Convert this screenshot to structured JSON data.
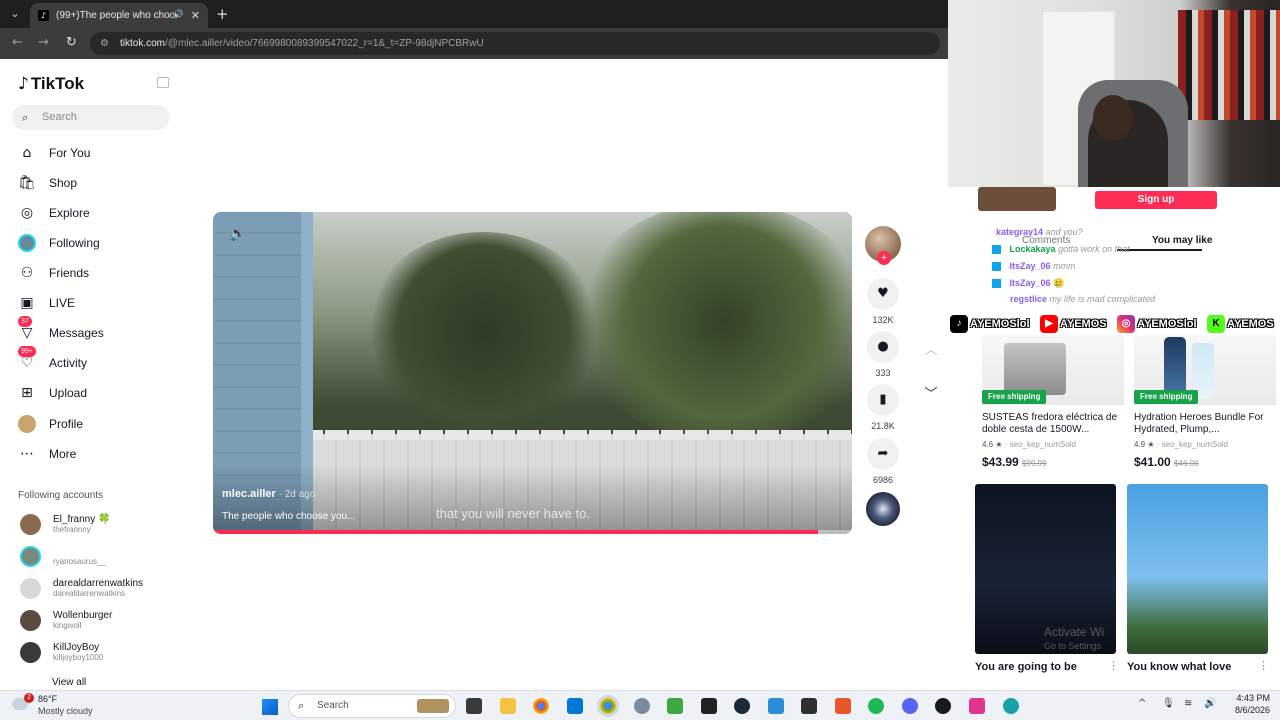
{
  "browser": {
    "tab_title": "(99+)The people who choo",
    "url_domain": "tiktok.com",
    "url_path": "/@mlec.ailler/video/7669980089399547022_r=1&_t=ZP-98djNPCBRwU"
  },
  "sidebar": {
    "logo": "TikTok",
    "search_placeholder": "Search",
    "nav": [
      {
        "label": "For You",
        "icon": "home-icon"
      },
      {
        "label": "Shop",
        "icon": "shop-icon"
      },
      {
        "label": "Explore",
        "icon": "compass-icon"
      },
      {
        "label": "Following",
        "icon": "following-avatar-icon"
      },
      {
        "label": "Friends",
        "icon": "friends-icon"
      },
      {
        "label": "LIVE",
        "icon": "live-icon"
      },
      {
        "label": "Messages",
        "icon": "messages-icon",
        "badge": "37"
      },
      {
        "label": "Activity",
        "icon": "activity-icon",
        "badge": "99+"
      },
      {
        "label": "Upload",
        "icon": "upload-icon"
      },
      {
        "label": "Profile",
        "icon": "profile-avatar-icon"
      },
      {
        "label": "More",
        "icon": "more-icon"
      }
    ],
    "following_heading": "Following accounts",
    "accounts": [
      {
        "name": "El_franny 🍀",
        "handle": "thefrannny"
      },
      {
        "name": "",
        "handle": "ryanosaurus__"
      },
      {
        "name": "darealdarrenwatkins",
        "handle": "darealdarrenwatkins"
      },
      {
        "name": "Wollenburger",
        "handle": "kingwoll"
      },
      {
        "name": "KillJoyBoy",
        "handle": "killjoyboy1000"
      }
    ],
    "view_all": "View all"
  },
  "video": {
    "author": "mlec.ailler",
    "ago": " · 2d ago",
    "description": "The people who choose you...",
    "caption": "that you will never have to.",
    "progress": 0.947
  },
  "actions": {
    "likes": "132K",
    "comments": "333",
    "saves": "21.8K",
    "shares": "6986"
  },
  "right_panel": {
    "signup": "Sign up",
    "tab_comments": "Comments",
    "tab_you_may_like": "You may like",
    "chat": [
      {
        "user": "kategray14",
        "msg": "and you?"
      },
      {
        "user": "Lockakaya",
        "msg": "gotta work on that"
      },
      {
        "user": "ItsZay_06",
        "msg": "mmm"
      },
      {
        "user": "ItsZay_06",
        "msg": "🥲"
      },
      {
        "user": "regstlice",
        "msg": "my life is mad complicated"
      }
    ],
    "socials": [
      "AYEMOSlol",
      "AYEMOS",
      "AYEMOSlol",
      "AYEMOS"
    ],
    "products": [
      {
        "badge": "Free shipping",
        "title": "SUSTEAS fredora eléctrica de doble cesta de 1500W...",
        "rating": "4.6 ★",
        "seller": " · seo_kep_numSold",
        "price": "$43.99",
        "old_price": "$99.99"
      },
      {
        "badge": "Free shipping",
        "title": "Hydration Heroes Bundle For Hydrated, Plump,...",
        "rating": "4.9 ★",
        "seller": " · seo_kep_numSold",
        "price": "$41.00",
        "old_price": "$46.00"
      }
    ],
    "videos": [
      {
        "title": "You are going to be"
      },
      {
        "title": "You know what love"
      }
    ],
    "watermark_title": "Activate Wi",
    "watermark_sub": "Go to Settings"
  },
  "taskbar": {
    "weather_badge": "2",
    "temp": "86°F",
    "weather": "Mostly cloudy",
    "search": "Search",
    "time": "4:43 PM",
    "date": "8/6/2026"
  },
  "colors": {
    "accent": "#fe2c55",
    "free_shipping": "#16a34a",
    "chat_user": "#8b5cf6"
  }
}
